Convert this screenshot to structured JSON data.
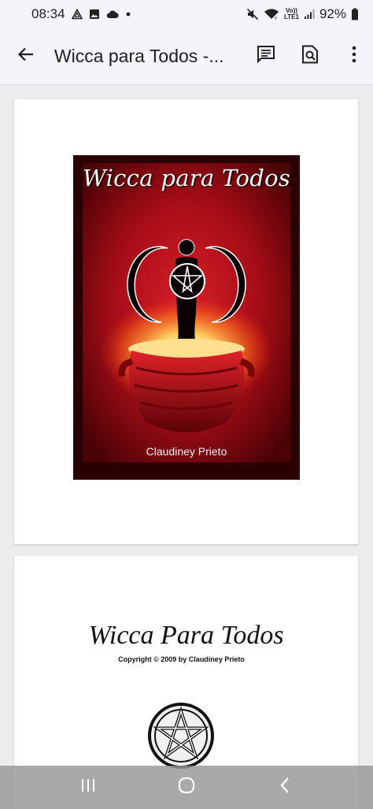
{
  "status_bar": {
    "time": "08:34",
    "volte_line1": "Vo))",
    "volte_line2": "LTE1",
    "battery": "92%"
  },
  "app_bar": {
    "title": "Wicca para Todos -..."
  },
  "pages": {
    "cover": {
      "title": "Wicca para Todos",
      "author": "Claudiney Prieto"
    },
    "title_page": {
      "title": "Wicca Para Todos",
      "copyright": "Copyright © 2009 by Claudiney Prieto"
    }
  },
  "colors": {
    "app_bar_bg": "#f4f5fb",
    "cover_red": "#b3121c",
    "cover_dark": "#2a0002",
    "page_bg": "#ffffff",
    "viewer_bg": "#ececec"
  },
  "icons": {
    "status_left": [
      "triangle-sync-icon",
      "gallery-icon",
      "cloud-icon",
      "dot-icon"
    ],
    "status_right": [
      "mute-icon",
      "wifi-icon",
      "volte-icon",
      "signal-icon",
      "battery-icon"
    ],
    "app_bar": [
      "back-arrow-icon",
      "comments-icon",
      "search-document-icon",
      "more-vert-icon"
    ],
    "nav": [
      "recents-icon",
      "home-icon",
      "back-icon"
    ]
  }
}
